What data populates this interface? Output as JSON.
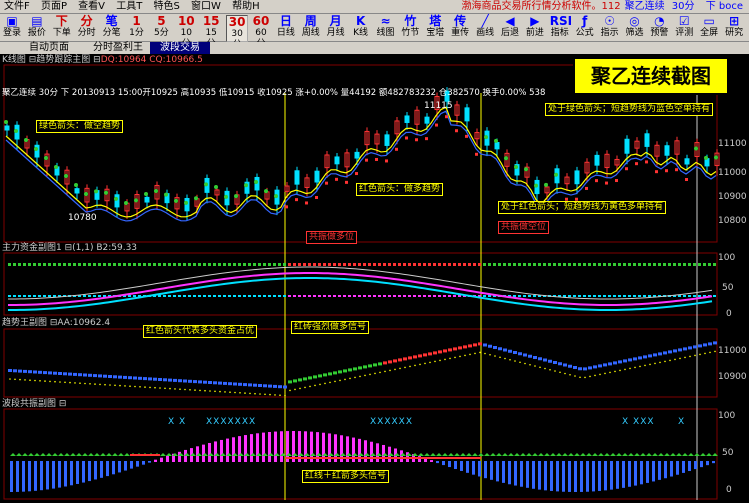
{
  "menu": {
    "items": [
      "文件F",
      "页面P",
      "查看V",
      "工具T",
      "特色S",
      "窗口W",
      "帮助H"
    ],
    "title_text": "渤海商品交易所行情分析软件。112",
    "title_product": "聚乙连续",
    "title_period": "30分",
    "title_end": "下 boce"
  },
  "toolbar": [
    {
      "icon": "▣",
      "label": "登录",
      "color": "blue"
    },
    {
      "icon": "▤",
      "label": "报价",
      "color": "blue"
    },
    {
      "icon": "下",
      "label": "下单",
      "color": "red"
    },
    {
      "icon": "分",
      "label": "分时",
      "color": "red"
    },
    {
      "icon": "笔",
      "label": "分笔",
      "color": "blue"
    },
    {
      "icon": "1",
      "label": "1分",
      "color": "red"
    },
    {
      "icon": "5",
      "label": "5分",
      "color": "red"
    },
    {
      "icon": "10",
      "label": "10分",
      "color": "red"
    },
    {
      "icon": "15",
      "label": "15分",
      "color": "red"
    },
    {
      "icon": "30",
      "label": "30分",
      "color": "red"
    },
    {
      "icon": "60",
      "label": "60分",
      "color": "red"
    },
    {
      "icon": "日",
      "label": "日线",
      "color": "blue"
    },
    {
      "icon": "周",
      "label": "周线",
      "color": "blue"
    },
    {
      "icon": "月",
      "label": "月线",
      "color": "blue"
    },
    {
      "icon": "K",
      "label": "K线",
      "color": "blue"
    },
    {
      "icon": "≈",
      "label": "线图",
      "color": "blue"
    },
    {
      "icon": "竹",
      "label": "竹节",
      "color": "blue"
    },
    {
      "icon": "塔",
      "label": "宝塔",
      "color": "blue"
    },
    {
      "icon": "传",
      "label": "重传",
      "color": "blue"
    },
    {
      "icon": "╱",
      "label": "画线",
      "color": "blue"
    },
    {
      "icon": "◀",
      "label": "后退",
      "color": "blue"
    },
    {
      "icon": "▶",
      "label": "前进",
      "color": "blue"
    },
    {
      "icon": "RSI",
      "label": "指标",
      "color": "blue"
    },
    {
      "icon": "ƒ",
      "label": "公式",
      "color": "blue"
    },
    {
      "icon": "☉",
      "label": "指示",
      "color": "blue"
    },
    {
      "icon": "◎",
      "label": "筛选",
      "color": "blue"
    },
    {
      "icon": "◔",
      "label": "预警",
      "color": "blue"
    },
    {
      "icon": "☑",
      "label": "评测",
      "color": "blue"
    },
    {
      "icon": "▭",
      "label": "全屏",
      "color": "blue"
    },
    {
      "icon": "⊞",
      "label": "研究",
      "color": "blue"
    }
  ],
  "tabs": [
    "自动页面",
    "分时盈利王",
    "波段交易"
  ],
  "promo": "聚乙连续截图",
  "main_panel": {
    "header": "K线图 ⊟趋势跟踪主图 ⊟",
    "header_red": "DQ:10964 CQ:10966.5",
    "info": "聚乙连续  30分  下 20130913 15:00开10925 高10935 低10915 收10925 涨+0.00% 量44192 额482783232 仓382570 换手0.00% 538",
    "price_high_label": "11115",
    "price_low_label": "10780",
    "axis": [
      "11100",
      "11000",
      "10900",
      "10800"
    ],
    "annotations": {
      "green_arrow": "绿色箭头：做空趋势",
      "red_arrow": "红色箭头：做多趋势",
      "top_right": "处于绿色箭头；短趋势线为蓝色空单持有",
      "bottom_right": "处于红色箭头；短趋势线为黄色多单持有",
      "long_pos": "共振做多位",
      "short_pos": "共振做空位"
    }
  },
  "fund_panel": {
    "header": "主力资金副图1 ⊟(1,1) B2:59.33",
    "axis": [
      "100",
      "50",
      "0"
    ],
    "annotation_1": "红色箭头代表多头资金占优",
    "annotation_2": "红砖强烈做多信号"
  },
  "trend_panel": {
    "header": "趋势王副图 ⊟AA:10962.4",
    "axis": [
      "11000",
      "10900"
    ]
  },
  "wave_panel": {
    "header": "波段共振副图 ⊟",
    "axis": [
      "100",
      "50",
      "0"
    ],
    "annotation": "红线＋红箭多头信号",
    "x_marks": [
      "X X",
      "XXXXXXX",
      "XXXXXX",
      "X XXX",
      "X"
    ]
  },
  "colors": {
    "up": "#ff3333",
    "down": "#00e0ff",
    "green": "#33cc33",
    "yellow": "#ffff00",
    "magenta": "#ff33ff",
    "blue": "#3366ff"
  }
}
